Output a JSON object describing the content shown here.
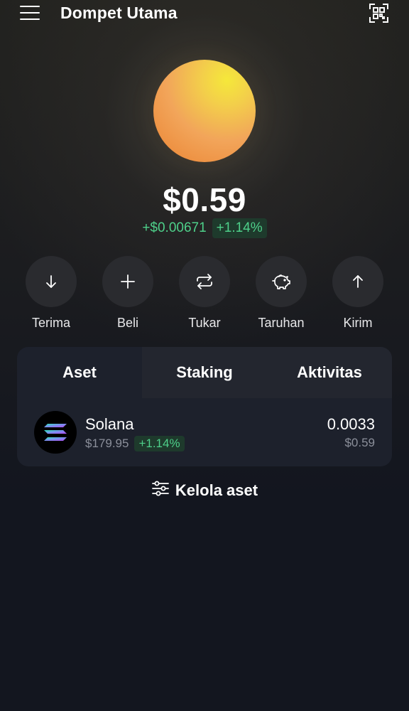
{
  "header": {
    "title": "Dompet Utama",
    "menu_icon": "menu-icon",
    "qr_icon": "qr-scan-icon"
  },
  "wallet": {
    "balance": "$0.59",
    "change_abs": "+$0.00671",
    "change_pct": "+1.14%",
    "accent_color": "#4ed08a"
  },
  "actions": [
    {
      "label": "Terima",
      "icon": "arrow-down-icon"
    },
    {
      "label": "Beli",
      "icon": "plus-icon"
    },
    {
      "label": "Tukar",
      "icon": "swap-icon"
    },
    {
      "label": "Taruhan",
      "icon": "piggy-bank-icon"
    },
    {
      "label": "Kirim",
      "icon": "arrow-up-icon"
    }
  ],
  "tabs": [
    {
      "label": "Aset",
      "active": true
    },
    {
      "label": "Staking",
      "active": false
    },
    {
      "label": "Aktivitas",
      "active": false
    }
  ],
  "assets": [
    {
      "name": "Solana",
      "price": "$179.95",
      "change_pct": "+1.14%",
      "amount": "0.0033",
      "value": "$0.59",
      "icon": "solana-icon"
    }
  ],
  "manage": {
    "label": "Kelola aset",
    "icon": "sliders-icon"
  }
}
